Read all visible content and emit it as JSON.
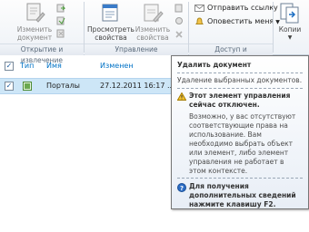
{
  "ribbon": {
    "checkout_label": "Изменить документ",
    "view_props_label": "Просмотреть свойства",
    "edit_props_label": "Изменить свойства",
    "send_link_label": "Отправить ссылку",
    "alert_me_label": "Оповестить меня",
    "copies_label": "Копии",
    "group_open": "Открытие и извлечение",
    "group_manage": "Управление",
    "group_share": "Доступ и отслеживание"
  },
  "list": {
    "col_type": "Тип",
    "col_name": "Имя",
    "col_modified": "Изменен",
    "row_name": "Порталы",
    "row_date": "27.12.2011 16:17",
    "row_ellipsis": "..."
  },
  "tooltip": {
    "title": "Удалить документ",
    "desc": "Удаление выбранных документов.",
    "warning": "Этот элемент управления сейчас отключен.",
    "body": "Возможно, у вас отсутствуют соответствующие права на использование. Вам необходимо выбрать объект или элемент, либо элемент управления не работает в этом контексте.",
    "help": "Для получения дополнительных сведений нажмите клавишу F2."
  },
  "colors": {
    "accent": "#0072c6",
    "selected_row": "#cde6f7"
  }
}
